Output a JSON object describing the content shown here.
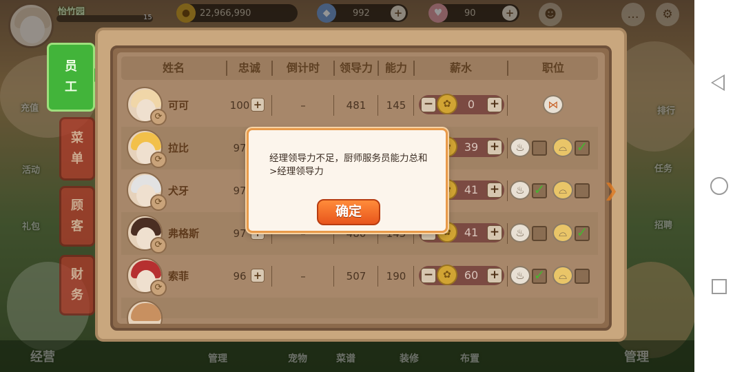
{
  "hud": {
    "player_name": "怡竹园",
    "level": "15",
    "gold": "22,966,990",
    "gems": "992",
    "tickets": "90",
    "plus": "+"
  },
  "side_tabs": [
    {
      "label": [
        "员",
        "工"
      ]
    },
    {
      "label": [
        "菜",
        "单"
      ]
    },
    {
      "label": [
        "顾",
        "客"
      ]
    },
    {
      "label": [
        "财",
        "务"
      ]
    }
  ],
  "table": {
    "headers": [
      "姓名",
      "忠诚",
      "倒计时",
      "领导力",
      "能力",
      "薪水",
      "职位"
    ],
    "rows": [
      {
        "name": "可可",
        "loyalty": "100",
        "countdown": "–",
        "leadership": "481",
        "ability": "145",
        "salary": "0",
        "position": "manager"
      },
      {
        "name": "拉比",
        "loyalty": "97",
        "countdown": "–",
        "leadership": "",
        "ability": "",
        "salary": "39",
        "position": "chef+waiter",
        "chef_checked": false,
        "waiter_checked": true
      },
      {
        "name": "犬牙",
        "loyalty": "97",
        "countdown": "–",
        "leadership": "",
        "ability": "",
        "salary": "41",
        "position": "chef+waiter",
        "chef_checked": true,
        "waiter_checked": false
      },
      {
        "name": "弗格斯",
        "loyalty": "97",
        "countdown": "–",
        "leadership": "480",
        "ability": "145",
        "salary": "41",
        "position": "chef+waiter",
        "chef_checked": false,
        "waiter_checked": true
      },
      {
        "name": "索菲",
        "loyalty": "96",
        "countdown": "–",
        "leadership": "507",
        "ability": "190",
        "salary": "60",
        "position": "chef+waiter",
        "chef_checked": true,
        "waiter_checked": false
      }
    ],
    "minus": "−",
    "plus": "+"
  },
  "dialog": {
    "message": "经理领导力不足，厨师服务员能力总和>经理领导力",
    "confirm": "确定"
  },
  "bottom_tabs": [
    "经营",
    "管理",
    "宠物",
    "菜谱",
    "装修",
    "布置",
    "管理"
  ],
  "right_side_labels": [
    "排行",
    "任务",
    "招聘"
  ],
  "left_side_labels": [
    "充值",
    "活动",
    "礼包"
  ]
}
